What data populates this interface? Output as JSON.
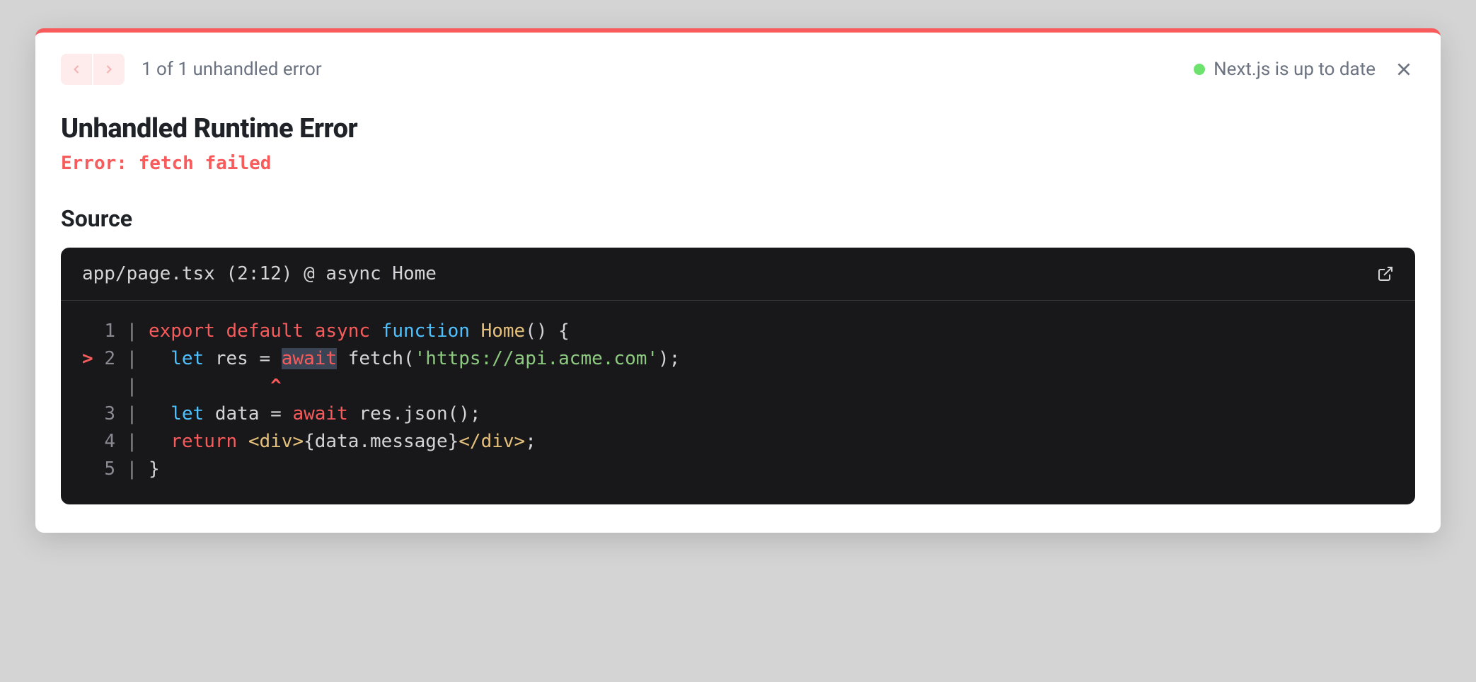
{
  "header": {
    "counter": "1 of 1 unhandled error",
    "status": "Next.js is up to date"
  },
  "error": {
    "title": "Unhandled Runtime Error",
    "message": "Error: fetch failed"
  },
  "source": {
    "section_label": "Source",
    "location": "app/page.tsx (2:12) @ async Home"
  },
  "code": {
    "line1_num": "1",
    "line2_num": "2",
    "line3_num": "3",
    "line4_num": "4",
    "line5_num": "5",
    "kw_export": "export",
    "kw_default": "default",
    "kw_async": "async",
    "kw_function": "function",
    "fn_home": "Home",
    "paren_brace": "() {",
    "kw_let": "let",
    "var_res": " res = ",
    "kw_await_hl": "await",
    "call_fetch": " fetch(",
    "str_url": "'https://api.acme.com'",
    "close_paren": ");",
    "caret": "^",
    "var_data": " data = ",
    "kw_await2": "await",
    "call_json": " res.json();",
    "kw_return": "return",
    "jsx_open": "<div>",
    "jsx_expr": "{data.message}",
    "jsx_close": "</div>",
    "semi": ";",
    "brace_close": "}"
  }
}
